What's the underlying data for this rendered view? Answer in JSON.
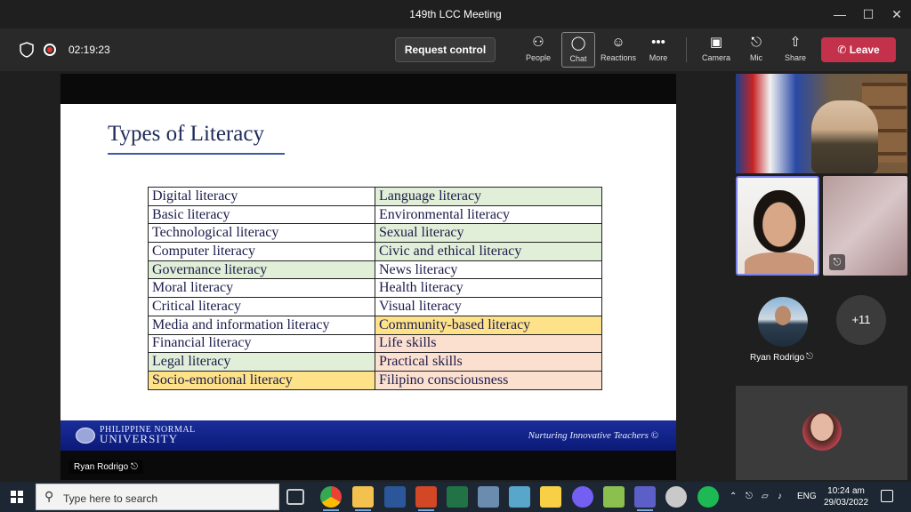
{
  "window": {
    "title": "149th LCC Meeting"
  },
  "toolbar": {
    "timer": "02:19:23",
    "request_control": "Request control",
    "buttons": {
      "people": "People",
      "chat": "Chat",
      "reactions": "Reactions",
      "more": "More",
      "camera": "Camera",
      "mic": "Mic",
      "share": "Share"
    },
    "leave": "Leave"
  },
  "slide": {
    "title": "Types of Literacy",
    "rows": [
      {
        "left": "Digital literacy",
        "left_bg": "white",
        "right": "Language literacy",
        "right_bg": "green"
      },
      {
        "left": "Basic literacy",
        "left_bg": "white",
        "right": "Environmental literacy",
        "right_bg": "white"
      },
      {
        "left": "Technological literacy",
        "left_bg": "white",
        "right": "Sexual literacy",
        "right_bg": "green"
      },
      {
        "left": "Computer literacy",
        "left_bg": "white",
        "right": "Civic and ethical literacy",
        "right_bg": "green"
      },
      {
        "left": "Governance literacy",
        "left_bg": "green",
        "right": "News literacy",
        "right_bg": "white"
      },
      {
        "left": "Moral literacy",
        "left_bg": "white",
        "right": "Health literacy",
        "right_bg": "white"
      },
      {
        "left": "Critical literacy",
        "left_bg": "white",
        "right": "Visual literacy",
        "right_bg": "white"
      },
      {
        "left": "Media and information literacy",
        "left_bg": "white",
        "right": "Community-based literacy",
        "right_bg": "yellow"
      },
      {
        "left": "Financial literacy",
        "left_bg": "white",
        "right": "Life skills",
        "right_bg": "peach"
      },
      {
        "left": "Legal literacy",
        "left_bg": "green",
        "right": "Practical skills",
        "right_bg": "peach"
      },
      {
        "left": "Socio-emotional literacy",
        "left_bg": "yellow",
        "right": "Filipino consciousness",
        "right_bg": "peach"
      }
    ],
    "footer": {
      "university_line1": "PHILIPPINE NORMAL",
      "university_line2": "UNIVERSITY",
      "tagline": "Nurturing Innovative Teachers ©"
    }
  },
  "presenter_tag": "Ryan Rodrigo",
  "participants": {
    "avatar_name": "Ryan Rodrigo",
    "overflow_count": "+11"
  },
  "taskbar": {
    "search_placeholder": "Type here to search",
    "language": "ENG",
    "time": "10:24 am",
    "date": "29/03/2022"
  },
  "colors": {
    "cell_white": "#ffffff",
    "cell_green": "#e2efd8",
    "cell_yellow": "#fde28a",
    "cell_peach": "#fbe0d0",
    "leave_red": "#c4314b",
    "active_border": "#7b83eb"
  }
}
